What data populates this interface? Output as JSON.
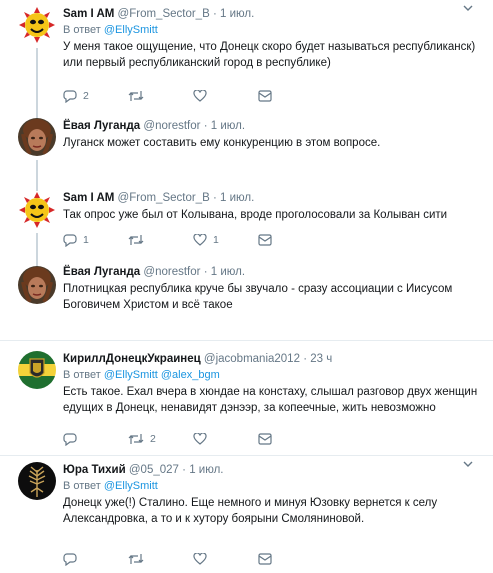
{
  "tweets": [
    {
      "name": "Sam I AM",
      "handle": "@From_Sector_B",
      "dot": "·",
      "time": "1 июл.",
      "reply_prefix": "В ответ",
      "reply_to": "@EllySmitt",
      "text": "У меня такое ощущение, что Донецк скоро будет называться республиканск) или первый республиканский город в республике)",
      "reply_count": "2",
      "retweet_count": "",
      "like_count": ""
    },
    {
      "name": "Ёвая Луганда",
      "handle": "@norestfor",
      "dot": "·",
      "time": "1 июл.",
      "text": "Луганск может составить ему конкуренцию в этом вопросе."
    },
    {
      "name": "Sam I AM",
      "handle": "@From_Sector_B",
      "dot": "·",
      "time": "1 июл.",
      "text": "Так опрос уже был от Колывана, вроде проголосовали за Колыван сити",
      "reply_count": "1",
      "retweet_count": "",
      "like_count": "1"
    },
    {
      "name": "Ёвая Луганда",
      "handle": "@norestfor",
      "dot": "·",
      "time": "1 июл.",
      "text": "Плотницкая республика круче бы звучало - сразу ассоциации с Иисусом Боговичем Христом и всё такое"
    },
    {
      "name": "КириллДонецкУкраинец",
      "handle": "@jacobmania2012",
      "dot": "·",
      "time": "23 ч",
      "reply_prefix": "В ответ",
      "reply_to": "@EllySmitt @alex_bgm",
      "text": "Есть такое. Ехал вчера в хюндае на констаху, слышал разговор двух женщин едущих в Донецк, ненавидят дэнээр, за копеечные, жить невозможно",
      "reply_count": "",
      "retweet_count": "2",
      "like_count": ""
    },
    {
      "name": "Юра Тихий",
      "handle": "@05_027",
      "dot": "·",
      "time": "1 июл.",
      "reply_prefix": "В ответ",
      "reply_to": "@EllySmitt",
      "text": "Донецк уже(!) Сталино. Еще немного и минуя Юзовку вернется к селу Александровка, а то и к хутору боярыни Смоляниновой.",
      "reply_count": "",
      "retweet_count": "",
      "like_count": ""
    }
  ],
  "colors": {
    "text": "#14171a",
    "muted": "#657786",
    "link": "#1b95e0",
    "thread_line": "#ccd6dd",
    "separator": "#e6ecf0"
  },
  "icons": [
    "reply-icon",
    "retweet-icon",
    "like-icon",
    "dm-icon",
    "caret-down-icon"
  ]
}
